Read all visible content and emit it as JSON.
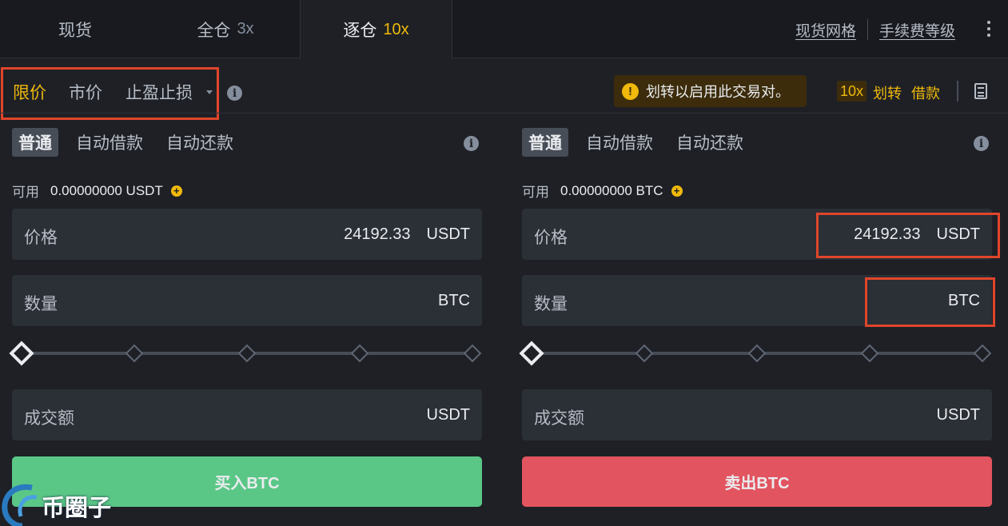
{
  "top_tabs": {
    "spot": {
      "label": "现货"
    },
    "cross": {
      "label": "全仓",
      "leverage": "3x"
    },
    "isolated": {
      "label": "逐仓",
      "leverage": "10x"
    }
  },
  "top_links": {
    "spot_grid": "现货网格",
    "fee_tier": "手续费等级"
  },
  "order_types": {
    "limit": "限价",
    "market": "市价",
    "stop_limit": "止盈止损"
  },
  "notice": {
    "text": "划转以启用此交易对。"
  },
  "actions": {
    "leverage": "10x",
    "transfer": "划转",
    "borrow": "借款"
  },
  "buy_panel": {
    "modes": [
      "普通",
      "自动借款",
      "自动还款"
    ],
    "available_label": "可用",
    "available_value": "0.00000000 USDT",
    "price_label": "价格",
    "price_value": "24192.33",
    "price_unit": "USDT",
    "amount_label": "数量",
    "amount_unit": "BTC",
    "total_label": "成交额",
    "total_unit": "USDT",
    "submit_label": "买入BTC"
  },
  "sell_panel": {
    "modes": [
      "普通",
      "自动借款",
      "自动还款"
    ],
    "available_label": "可用",
    "available_value": "0.00000000 BTC",
    "price_label": "价格",
    "price_value": "24192.33",
    "price_unit": "USDT",
    "amount_label": "数量",
    "amount_unit": "BTC",
    "total_label": "成交额",
    "total_unit": "USDT",
    "submit_label": "卖出BTC"
  },
  "slider": {
    "value_percent": 0,
    "marks": [
      0,
      25,
      50,
      75,
      100
    ]
  },
  "watermark": {
    "text": "币圈子"
  },
  "colors": {
    "accent": "#f0b90b",
    "buy": "#5ac787",
    "sell": "#e2545f",
    "highlight": "#e0452b"
  }
}
